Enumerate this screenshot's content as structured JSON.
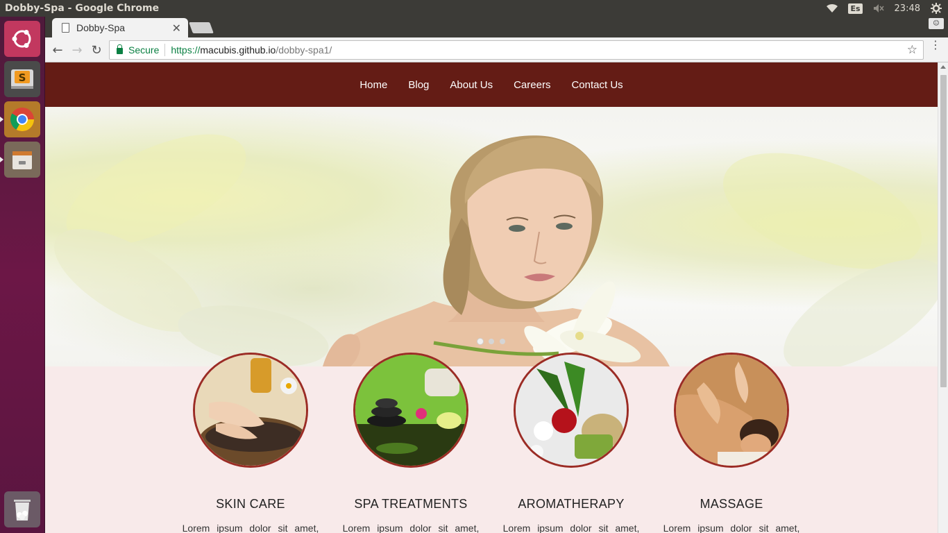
{
  "os": {
    "window_title": "Dobby-Spa - Google Chrome",
    "keyboard_layout": "Es",
    "clock": "23:48",
    "launcher": [
      "ubuntu-dash",
      "sublime-text",
      "google-chrome",
      "file-manager",
      "trash"
    ]
  },
  "browser": {
    "tab_title": "Dobby-Spa",
    "secure_label": "Secure",
    "url_scheme": "https://",
    "url_host": "macubis.github.io",
    "url_path": "/dobby-spa1/"
  },
  "site": {
    "nav": [
      "Home",
      "Blog",
      "About Us",
      "Careers",
      "Contact Us"
    ],
    "carousel": {
      "slides": 3,
      "active_index": 0
    },
    "services": [
      {
        "name": "SKIN CARE",
        "desc": "Lorem ipsum dolor sit amet,"
      },
      {
        "name": "SPA TREATMENTS",
        "desc": "Lorem ipsum dolor sit amet,"
      },
      {
        "name": "AROMATHERAPY",
        "desc": "Lorem ipsum dolor sit amet,"
      },
      {
        "name": "MASSAGE",
        "desc": "Lorem ipsum dolor sit amet,"
      }
    ],
    "colors": {
      "nav_bg": "#641c15",
      "section_bg": "#f8eaea",
      "circle_border": "#9b2c25"
    }
  }
}
